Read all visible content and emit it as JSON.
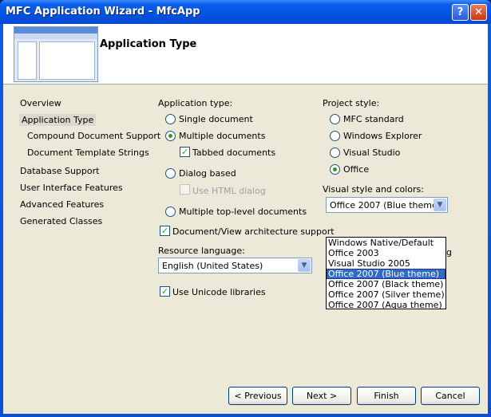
{
  "window": {
    "title": "MFC Application Wizard - MfcApp",
    "help_glyph": "?",
    "close_glyph": "✕"
  },
  "header": {
    "page_title": "Application Type"
  },
  "sidebar": {
    "items": [
      {
        "label": "Overview"
      },
      {
        "label": "Application Type"
      },
      {
        "label": "Compound Document Support"
      },
      {
        "label": "Document Template Strings"
      },
      {
        "label": "Database Support"
      },
      {
        "label": "User Interface Features"
      },
      {
        "label": "Advanced Features"
      },
      {
        "label": "Generated Classes"
      }
    ],
    "selected": "Application Type"
  },
  "app_type": {
    "label": "Application type:",
    "single": "Single document",
    "multiple": "Multiple documents",
    "tabbed": "Tabbed documents",
    "dialog": "Dialog based",
    "html_dialog": "Use HTML dialog",
    "top_level": "Multiple top-level documents",
    "selected": "Multiple documents",
    "tabbed_checked": true
  },
  "docview": {
    "label": "Document/View architecture support",
    "checked": true
  },
  "resource": {
    "label": "Resource language:",
    "value": "English (United States)"
  },
  "unicode": {
    "label": "Use Unicode libraries",
    "checked": true
  },
  "project_style": {
    "label": "Project style:",
    "mfc": "MFC standard",
    "explorer": "Windows Explorer",
    "vs": "Visual Studio",
    "office": "Office",
    "selected": "Office"
  },
  "visual_style": {
    "label": "Visual style and colors:",
    "value": "Office 2007 (Blue theme)",
    "options": [
      "Windows Native/Default",
      "Office 2003",
      "Visual Studio 2005",
      "Office 2007 (Blue theme)",
      "Office 2007 (Black theme)",
      "Office 2007 (Silver theme)",
      "Office 2007 (Aqua theme)"
    ],
    "selected_index": 3,
    "hidden_tail": "g"
  },
  "buttons": {
    "previous": "< Previous",
    "next": "Next >",
    "finish": "Finish",
    "cancel": "Cancel"
  }
}
